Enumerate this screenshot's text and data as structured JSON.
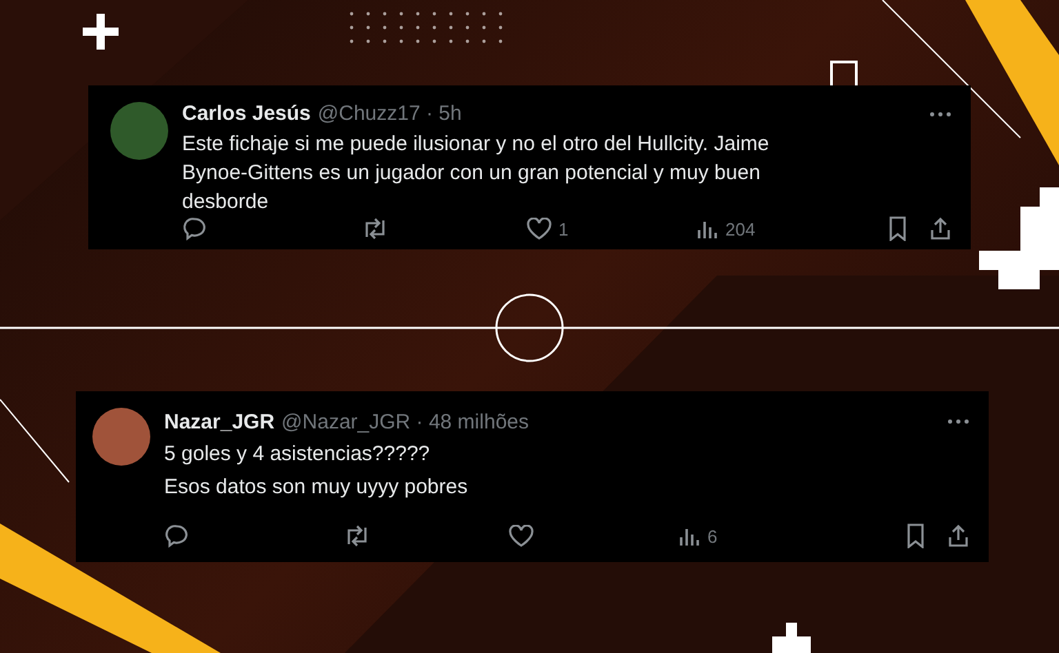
{
  "tweets": [
    {
      "name": "Carlos Jesús",
      "meta": "@Chuzz17 · 5h",
      "lines": [
        "Este fichaje si me puede ilusionar y no el otro del Hullcity. Jaime Bynoe-Gittens es un jugador con un gran potencial y muy buen desborde"
      ],
      "likes": "1",
      "views": "204"
    },
    {
      "name": "Nazar_JGR",
      "meta": "@Nazar_JGR · 48 milhões",
      "lines": [
        "5 goles y 4 asistencias?????",
        "Esos datos son muy uyyy pobres"
      ],
      "views": "6"
    }
  ]
}
